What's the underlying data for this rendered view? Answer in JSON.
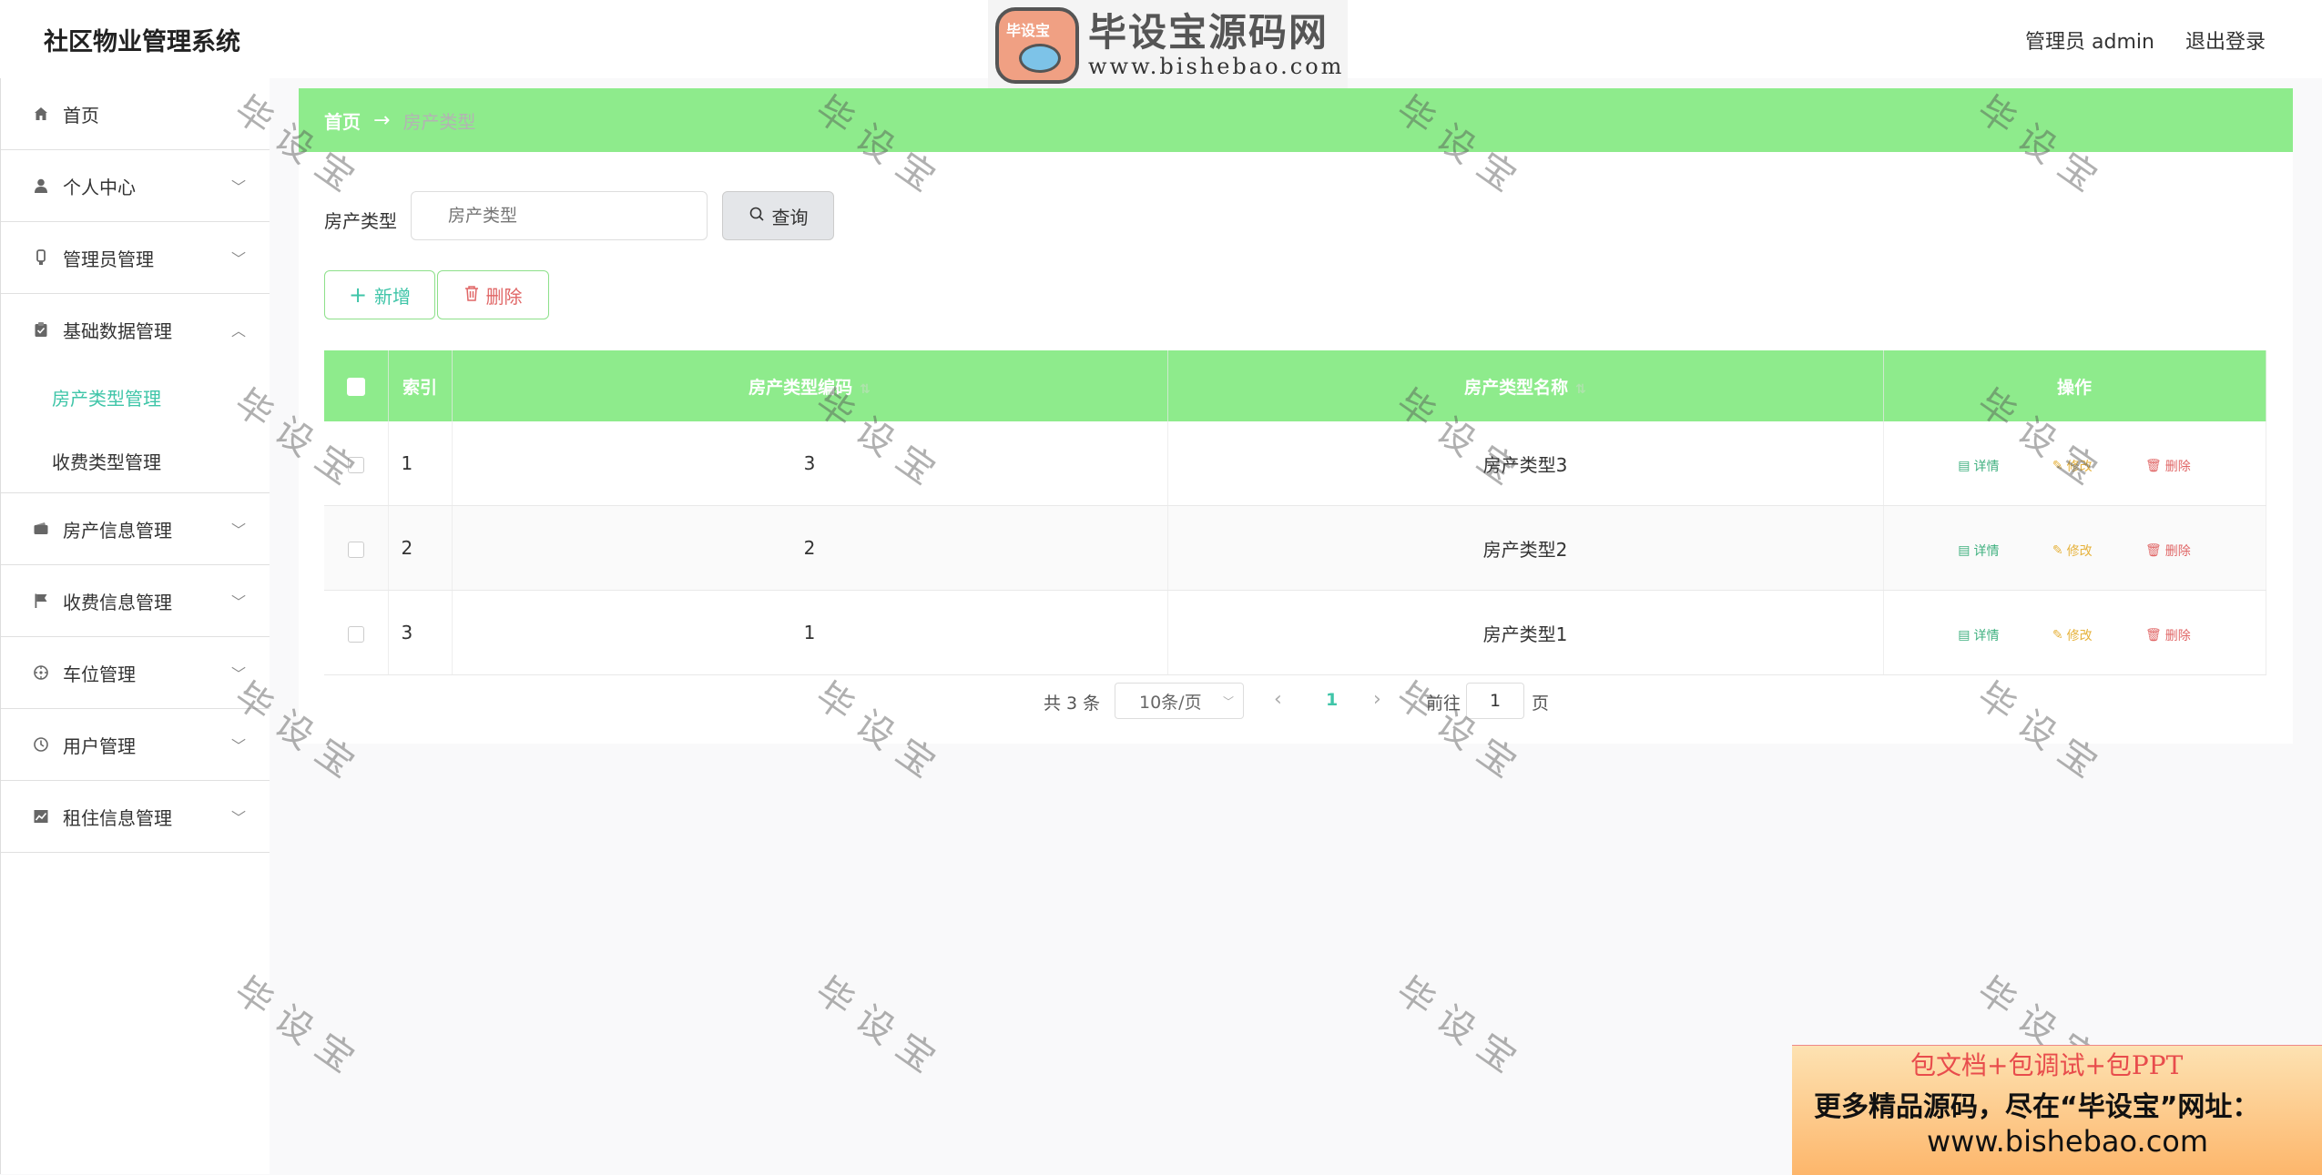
{
  "header": {
    "title": "社区物业管理系统",
    "user_label": "管理员 admin",
    "logout_label": "退出登录",
    "logo_badge": "毕设宝",
    "logo_text": "毕设宝源码网",
    "logo_url": "www.bishebao.com"
  },
  "sidebar": {
    "items": [
      {
        "label": "首页",
        "icon": "home-icon"
      },
      {
        "label": "个人中心",
        "icon": "user-icon"
      },
      {
        "label": "管理员管理",
        "icon": "admin-icon"
      },
      {
        "label": "基础数据管理",
        "icon": "clipboard-icon",
        "expanded": true
      },
      {
        "label": "房产信息管理",
        "icon": "wallet-icon"
      },
      {
        "label": "收费信息管理",
        "icon": "flag-icon"
      },
      {
        "label": "车位管理",
        "icon": "compass-icon"
      },
      {
        "label": "用户管理",
        "icon": "clock-icon"
      },
      {
        "label": "租住信息管理",
        "icon": "chart-icon"
      }
    ],
    "subitems": [
      {
        "label": "房产类型管理",
        "active": true
      },
      {
        "label": "收费类型管理",
        "active": false
      }
    ]
  },
  "breadcrumb": {
    "home": "首页",
    "arrow": "→",
    "current": "房产类型"
  },
  "search": {
    "label": "房产类型",
    "placeholder": "房产类型",
    "button": "查询"
  },
  "actions": {
    "add": "新增",
    "delete": "删除"
  },
  "table": {
    "headers": {
      "index": "索引",
      "code": "房产类型编码",
      "name": "房产类型名称",
      "ops": "操作"
    },
    "rows": [
      {
        "index": "1",
        "code": "3",
        "name": "房产类型3"
      },
      {
        "index": "2",
        "code": "2",
        "name": "房产类型2"
      },
      {
        "index": "3",
        "code": "1",
        "name": "房产类型1"
      }
    ],
    "row_actions": {
      "detail": "详情",
      "edit": "修改",
      "delete": "删除"
    }
  },
  "pagination": {
    "total": "共 3 条",
    "page_size": "10条/页",
    "current": "1",
    "goto": "前往",
    "goto_value": "1",
    "unit": "页"
  },
  "watermark": "毕设宝",
  "ad": {
    "line1": "包文档+包调试+包PPT",
    "line2": "更多精品源码，尽在“毕设宝”网址：",
    "line3": "www.bishebao.com"
  },
  "colors": {
    "accent_green": "#8eeb8c",
    "teal": "#3fc5a8",
    "danger": "#e06666",
    "warning": "#e6b23c"
  }
}
